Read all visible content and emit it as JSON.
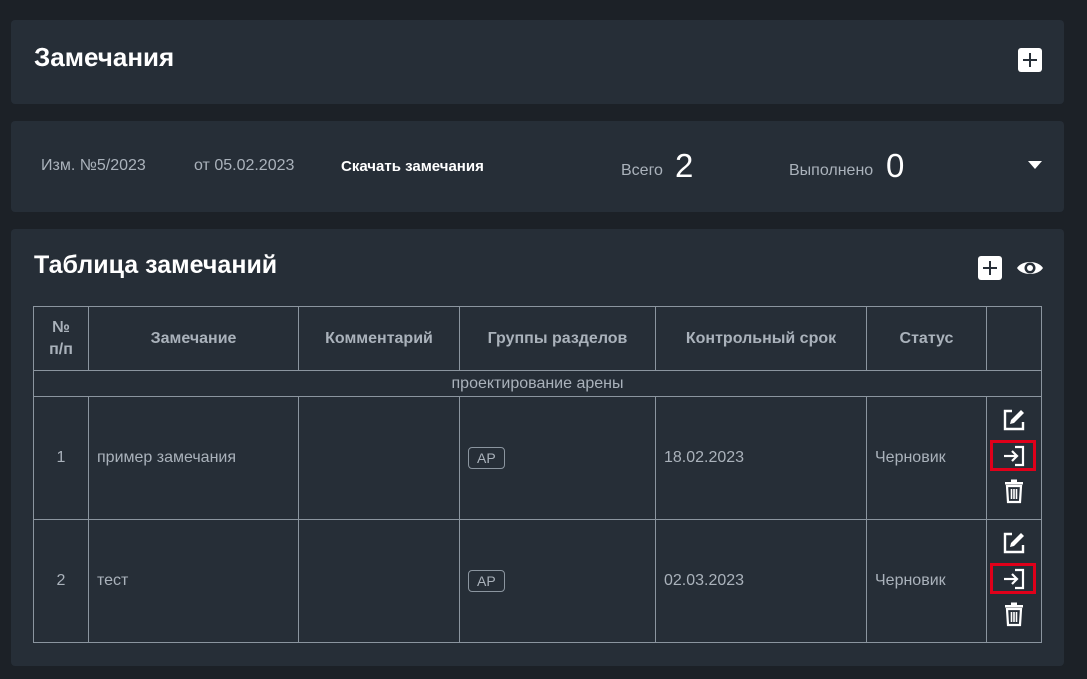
{
  "header": {
    "title": "Замечания"
  },
  "revision": {
    "number": "Изм. №5/2023",
    "date": "от 05.02.2023",
    "download_label": "Скачать замечания",
    "total_label": "Всего",
    "total_value": "2",
    "done_label": "Выполнено",
    "done_value": "0"
  },
  "remarks_table": {
    "title": "Таблица замечаний",
    "columns": [
      "№\nп/п",
      "Замечание",
      "Комментарий",
      "Группы разделов",
      "Контрольный срок",
      "Статус",
      ""
    ],
    "group": "проектирование арены",
    "rows": [
      {
        "num": "1",
        "remark": "пример замечания",
        "comment": "",
        "section_group": "АР",
        "deadline": "18.02.2023",
        "status": "Черновик"
      },
      {
        "num": "2",
        "remark": "тест",
        "comment": "",
        "section_group": "АР",
        "deadline": "02.03.2023",
        "status": "Черновик"
      }
    ]
  },
  "icons": {
    "add": "plus-icon",
    "view": "eye-icon",
    "expand": "chevron-down-icon",
    "edit": "edit-icon",
    "submit": "enter-icon",
    "delete": "trash-icon"
  },
  "colors": {
    "background": "#1c2127",
    "card": "#262e37",
    "highlight": "#e0001a",
    "muted_text": "#aab2bb"
  }
}
